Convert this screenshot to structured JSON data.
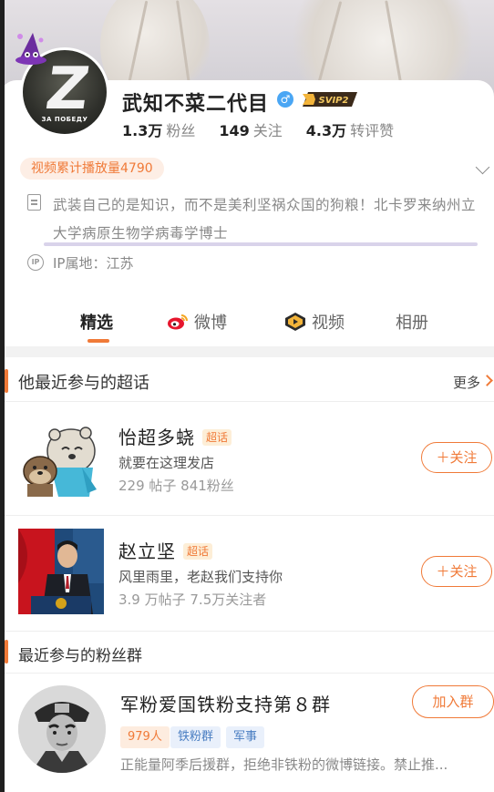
{
  "profile": {
    "name": "武知不菜二代目",
    "gender_symbol": "♂",
    "vip_label": "SVIP2",
    "avatar_caption": "ЗА ПОБЕДУ",
    "stats": [
      {
        "num": "1.3万",
        "label": "粉丝"
      },
      {
        "num": "149",
        "label": "关注"
      },
      {
        "num": "4.3万",
        "label": "转评赞"
      }
    ],
    "video_play_count": "视频累计播放量4790",
    "bio": "武装自己的是知识，而不是美利坚祸众国的狗粮！北卡罗来纳州立大学病原生物学病毒学博士",
    "ip_icon_text": "IP",
    "ip_location": "IP属地：江苏"
  },
  "tabs": [
    {
      "label": "精选",
      "icon": ""
    },
    {
      "label": "微博",
      "icon": "weibo-icon"
    },
    {
      "label": "视频",
      "icon": "video-icon"
    },
    {
      "label": "相册",
      "icon": ""
    }
  ],
  "super_topics": {
    "section_title": "他最近参与的超话",
    "more_label": "更多",
    "items": [
      {
        "title": "怡超多蛲",
        "badge": "超话",
        "subtitle": "就要在这理发店",
        "meta": "229 帖子 841粉丝",
        "button": "＋关注"
      },
      {
        "title": "赵立坚",
        "badge": "超话",
        "subtitle": "风里雨里，老赵我们支持你",
        "meta": "3.9 万帖子 7.5万关注者",
        "button": "＋关注"
      }
    ]
  },
  "fan_groups": {
    "section_title": "最近参与的粉丝群",
    "items": [
      {
        "title": "军粉爱国铁粉支持第８群",
        "member_count": "979人",
        "tags": [
          "铁粉群",
          "军事"
        ],
        "description": "正能量阿季后援群，拒绝非铁粉的微博链接。禁止推...",
        "button": "加入群"
      }
    ]
  },
  "colors": {
    "accent": "#f07a38",
    "vip_gold": "#f3b43a",
    "gender_blue": "#4aa6f4"
  }
}
